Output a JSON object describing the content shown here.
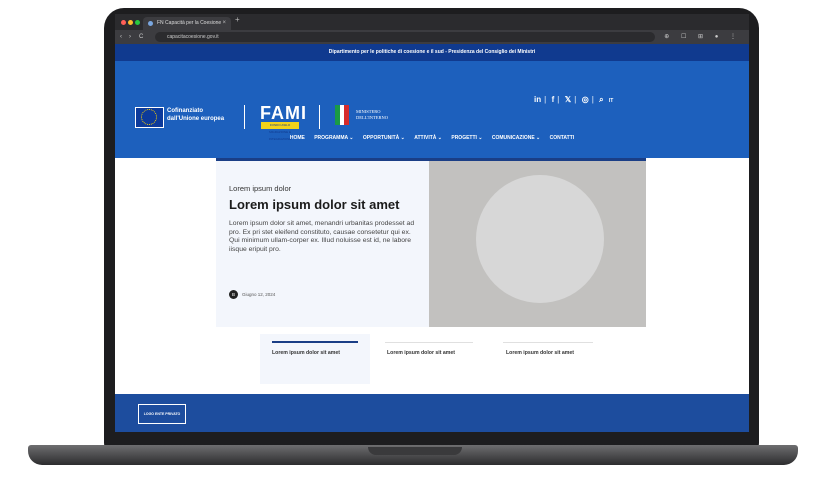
{
  "browser": {
    "tab_title": "FN Capacità per la Coesione",
    "url": "capacitacoesione.gov.it",
    "nav": [
      "‹",
      "›",
      "C"
    ]
  },
  "site": {
    "top_strip": "Dipartimento per le politiche di coesione e il sud - Presidenza del Consiglio dei Ministri",
    "cofunded_line1": "Cofinanziato",
    "cofunded_line2": "dall'Unione europea",
    "fami_logo": "FAMI",
    "fami_sub": "FONDO ASILO MIGRAZIONE E INTEGRAZIONE",
    "ministero_line1": "MINISTERO",
    "ministero_line2": "DELL'INTERNO",
    "social": [
      "in",
      "f",
      "𝕏",
      "◎",
      "⌕"
    ],
    "lang": "IT",
    "menu": [
      "HOME",
      "PROGRAMMA ⌄",
      "OPPORTUNITÀ ⌄",
      "ATTIVITÀ ⌄",
      "PROGETTI ⌄",
      "COMUNICAZIONE ⌄",
      "CONTATTI"
    ]
  },
  "hero": {
    "kicker": "Lorem ipsum dolor",
    "title": "Lorem ipsum dolor sit amet",
    "body": "Lorem ipsum dolor sit amet, menandri urbanitas prodesset ad pro. Ex pri stet eleifend constituto, causae consetetur qui ex. Qui minimum ullam-corper ex. Illud noluisse est id, ne labore iisque eripuit pro.",
    "avatar_letter": "B",
    "date": "Giugno 12, 2024"
  },
  "tabs": [
    {
      "label": "Lorem ipsum dolor sit amet"
    },
    {
      "label": "Lorem ipsum dolor sit amet"
    },
    {
      "label": "Lorem ipsum dolor sit amet"
    }
  ],
  "footer": {
    "logo_text": "LOGO ENTE PRIVATO"
  },
  "colors": {
    "strip": "#103a8f",
    "header": "#1d60bd",
    "footer": "#1d4d9e",
    "accent": "#1a3e86"
  }
}
